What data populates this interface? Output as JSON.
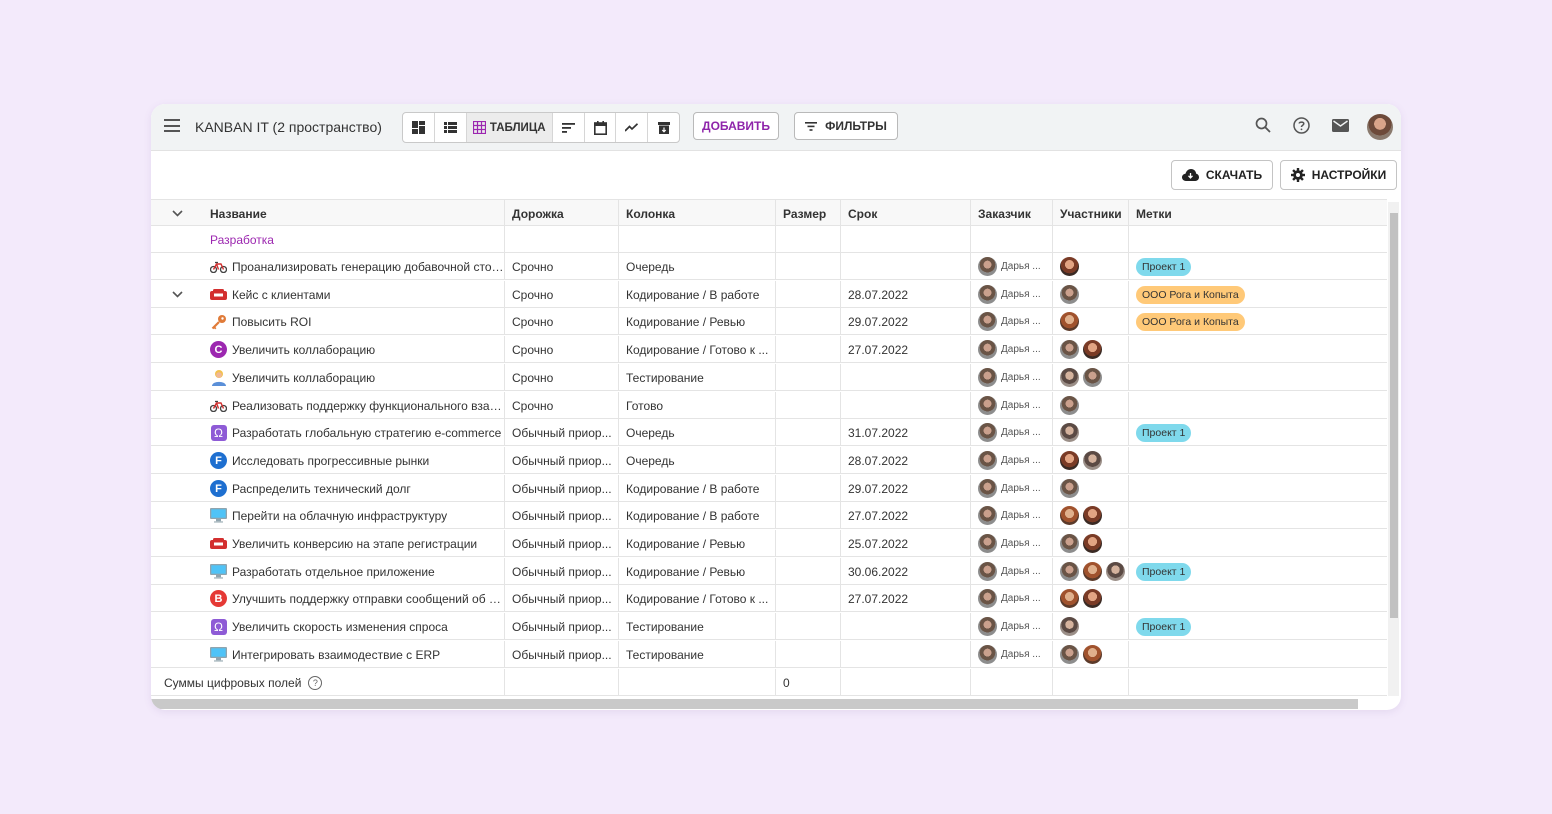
{
  "app": {
    "title": "KANBAN IT (2 пространство)"
  },
  "toolbar": {
    "table_view_label": "ТАБЛИЦА",
    "add_label": "ДОБАВИТЬ",
    "filters_label": "ФИЛЬТРЫ",
    "download_label": "СКАЧАТЬ",
    "settings_label": "НАСТРОЙКИ"
  },
  "colors": {
    "accent": "#8e24aa",
    "tag_blue": "#7fd9ec",
    "tag_orange": "#ffc978",
    "background": "#f3eafb"
  },
  "table": {
    "headers": {
      "name": "Название",
      "lane": "Дорожка",
      "column": "Колонка",
      "size": "Размер",
      "due": "Срок",
      "customer": "Заказчик",
      "members": "Участники",
      "tags": "Метки"
    },
    "group": "Разработка",
    "rows": [
      {
        "icon": "bicycle",
        "name": "Проанализировать генерацию добавочной стои...",
        "lane": "Срочно",
        "column": "Очередь",
        "size": "",
        "due": "",
        "customer": "Дарья ...",
        "members": [
          "a2"
        ],
        "tag": "Проект 1",
        "tag_color": "blue"
      },
      {
        "icon": "phone",
        "name": "Кейс с клиентами",
        "lane": "Срочно",
        "column": "Кодирование / В работе",
        "size": "",
        "due": "28.07.2022",
        "customer": "Дарья ...",
        "members": [
          "a1"
        ],
        "tag": "ООО Рога и Копыта",
        "tag_color": "orange",
        "expand": true
      },
      {
        "icon": "key",
        "name": "Повысить ROI",
        "lane": "Срочно",
        "column": "Кодирование / Ревью",
        "size": "",
        "due": "29.07.2022",
        "customer": "Дарья ...",
        "members": [
          "a4"
        ],
        "tag": "ООО Рога и Копыта",
        "tag_color": "orange"
      },
      {
        "icon": "letter",
        "letter": "C",
        "letter_color": "#9c27b0",
        "name": "Увеличить коллаборацию",
        "lane": "Срочно",
        "column": "Кодирование / Готово к ...",
        "size": "",
        "due": "27.07.2022",
        "customer": "Дарья ...",
        "members": [
          "a1",
          "a2"
        ],
        "tag": ""
      },
      {
        "icon": "person",
        "name": "Увеличить коллаборацию",
        "lane": "Срочно",
        "column": "Тестирование",
        "size": "",
        "due": "",
        "customer": "Дарья ...",
        "members": [
          "a3",
          "a1"
        ],
        "tag": ""
      },
      {
        "icon": "bicycle",
        "name": "Реализовать поддержку функционального взаи...",
        "lane": "Срочно",
        "column": "Готово",
        "size": "",
        "due": "",
        "customer": "Дарья ...",
        "members": [
          "a1"
        ],
        "tag": ""
      },
      {
        "icon": "omega",
        "name": "Разработать глобальную стратегию e-commerce",
        "lane": "Обычный приор...",
        "column": "Очередь",
        "size": "",
        "due": "31.07.2022",
        "customer": "Дарья ...",
        "members": [
          "a3"
        ],
        "tag": "Проект 1",
        "tag_color": "blue"
      },
      {
        "icon": "letter",
        "letter": "F",
        "letter_color": "#1e6fd0",
        "name": "Исследовать прогрессивные рынки",
        "lane": "Обычный приор...",
        "column": "Очередь",
        "size": "",
        "due": "28.07.2022",
        "customer": "Дарья ...",
        "members": [
          "a2",
          "a3"
        ],
        "tag": ""
      },
      {
        "icon": "letter",
        "letter": "F",
        "letter_color": "#1e6fd0",
        "name": "Распределить технический долг",
        "lane": "Обычный приор...",
        "column": "Кодирование / В работе",
        "size": "",
        "due": "29.07.2022",
        "customer": "Дарья ...",
        "members": [
          "a1"
        ],
        "tag": ""
      },
      {
        "icon": "monitor",
        "name": "Перейти на облачную инфраструктуру",
        "lane": "Обычный приор...",
        "column": "Кодирование / В работе",
        "size": "",
        "due": "27.07.2022",
        "customer": "Дарья ...",
        "members": [
          "a4",
          "a2"
        ],
        "tag": ""
      },
      {
        "icon": "phone",
        "name": "Увеличить конверсию на этапе регистрации",
        "lane": "Обычный приор...",
        "column": "Кодирование / Ревью",
        "size": "",
        "due": "25.07.2022",
        "customer": "Дарья ...",
        "members": [
          "a1",
          "a2"
        ],
        "tag": ""
      },
      {
        "icon": "monitor",
        "name": "Разработать отдельное приложение",
        "lane": "Обычный приор...",
        "column": "Кодирование / Ревью",
        "size": "",
        "due": "30.06.2022",
        "customer": "Дарья ...",
        "members": [
          "a1",
          "a4",
          "a3"
        ],
        "tag": "Проект 1",
        "tag_color": "blue"
      },
      {
        "icon": "letter",
        "letter": "B",
        "letter_color": "#e53935",
        "name": "Улучшить поддержку отправки сообщений об о...",
        "lane": "Обычный приор...",
        "column": "Кодирование / Готово к ...",
        "size": "",
        "due": "27.07.2022",
        "customer": "Дарья ...",
        "members": [
          "a4",
          "a2"
        ],
        "tag": ""
      },
      {
        "icon": "omega",
        "name": "Увеличить скорость изменения спроса",
        "lane": "Обычный приор...",
        "column": "Тестирование",
        "size": "",
        "due": "",
        "customer": "Дарья ...",
        "members": [
          "a3"
        ],
        "tag": "Проект 1",
        "tag_color": "blue"
      },
      {
        "icon": "monitor",
        "name": "Интегрировать взаимодествие с ERP",
        "lane": "Обычный приор...",
        "column": "Тестирование",
        "size": "",
        "due": "",
        "customer": "Дарья ...",
        "members": [
          "a1",
          "a4"
        ],
        "tag": ""
      }
    ],
    "footer": {
      "label": "Суммы цифровых полей",
      "size_sum": "0"
    }
  }
}
